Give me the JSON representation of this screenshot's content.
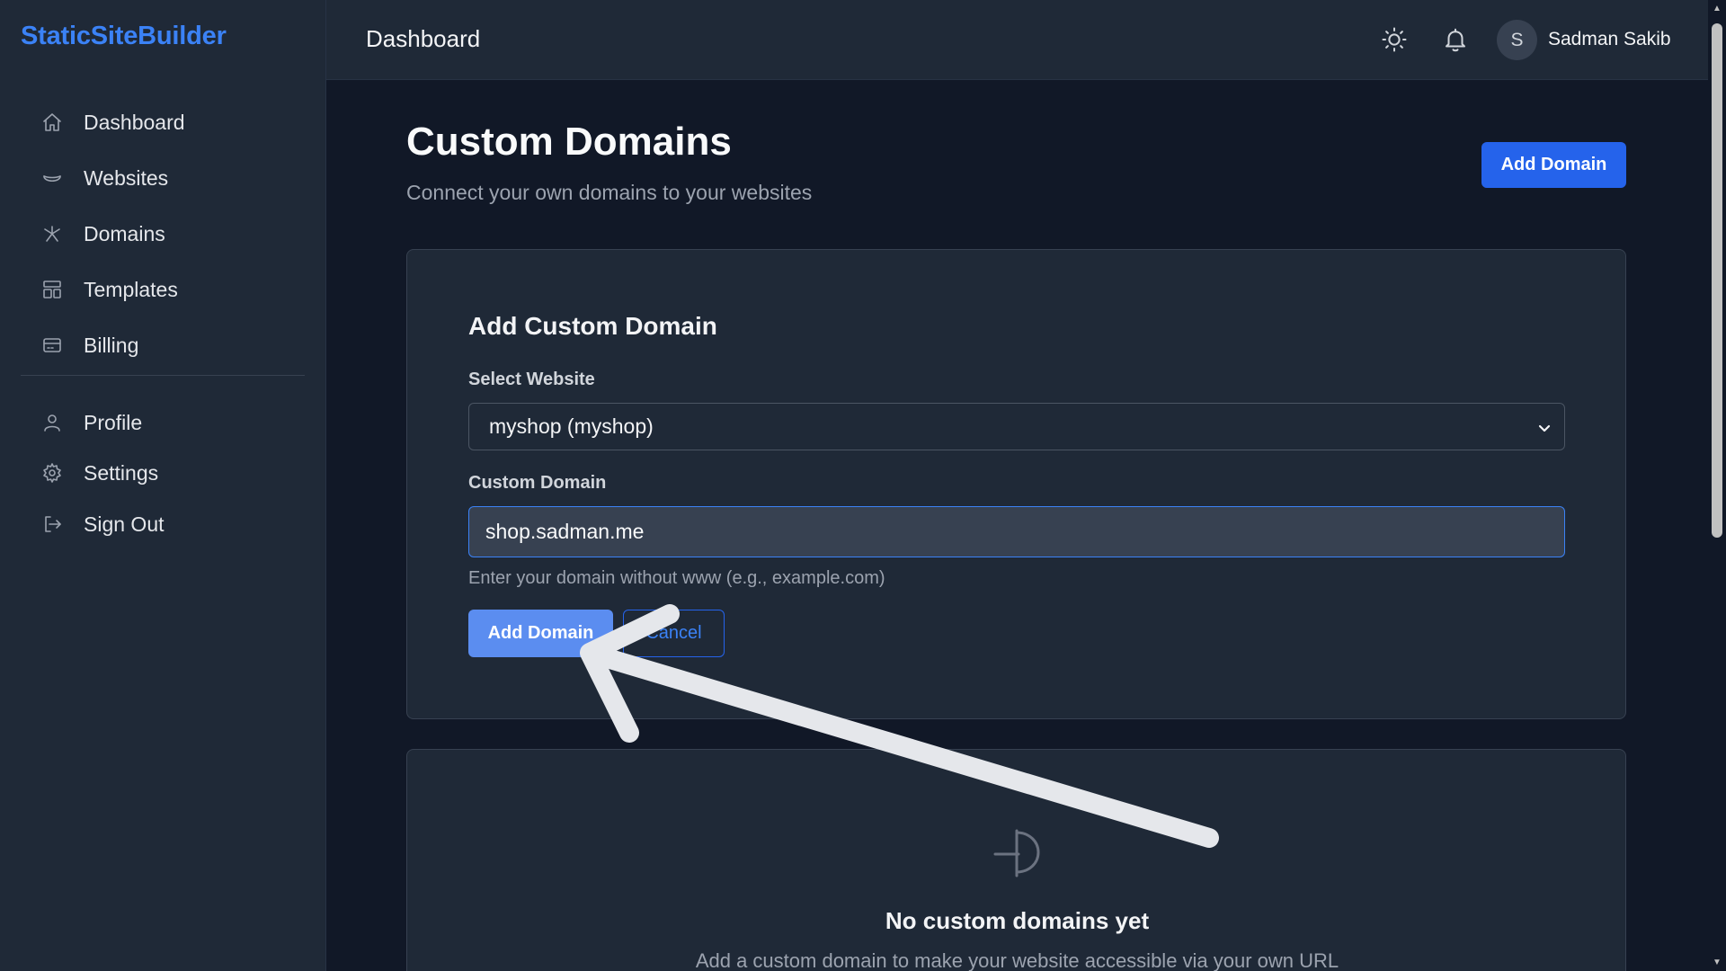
{
  "sidebar": {
    "brand": "StaticSiteBuilder",
    "items": [
      {
        "label": "Dashboard",
        "icon": "home-icon"
      },
      {
        "label": "Websites",
        "icon": "globe-icon"
      },
      {
        "label": "Domains",
        "icon": "network-icon"
      },
      {
        "label": "Templates",
        "icon": "template-icon"
      },
      {
        "label": "Billing",
        "icon": "credit-card-icon"
      }
    ],
    "account_items": [
      {
        "label": "Profile",
        "icon": "user-icon"
      },
      {
        "label": "Settings",
        "icon": "gear-icon"
      },
      {
        "label": "Sign Out",
        "icon": "sign-out-icon"
      }
    ]
  },
  "header": {
    "title": "Dashboard",
    "avatar_initial": "S",
    "user_name": "Sadman Sakib"
  },
  "page": {
    "title": "Custom Domains",
    "subtitle": "Connect your own domains to your websites",
    "add_button": "Add Domain"
  },
  "form": {
    "title": "Add Custom Domain",
    "website_label": "Select Website",
    "website_selected": "myshop (myshop)",
    "domain_label": "Custom Domain",
    "domain_value": "shop.sadman.me",
    "help_text": "Enter your domain without www (e.g., example.com)",
    "submit_label": "Add Domain",
    "cancel_label": "Cancel"
  },
  "empty_state": {
    "title": "No custom domains yet",
    "description": "Add a custom domain to make your website accessible via your own URL"
  },
  "colors": {
    "accent": "#2563eb",
    "brand": "#3b82f6",
    "background": "#111827",
    "panel": "#1f2937"
  }
}
